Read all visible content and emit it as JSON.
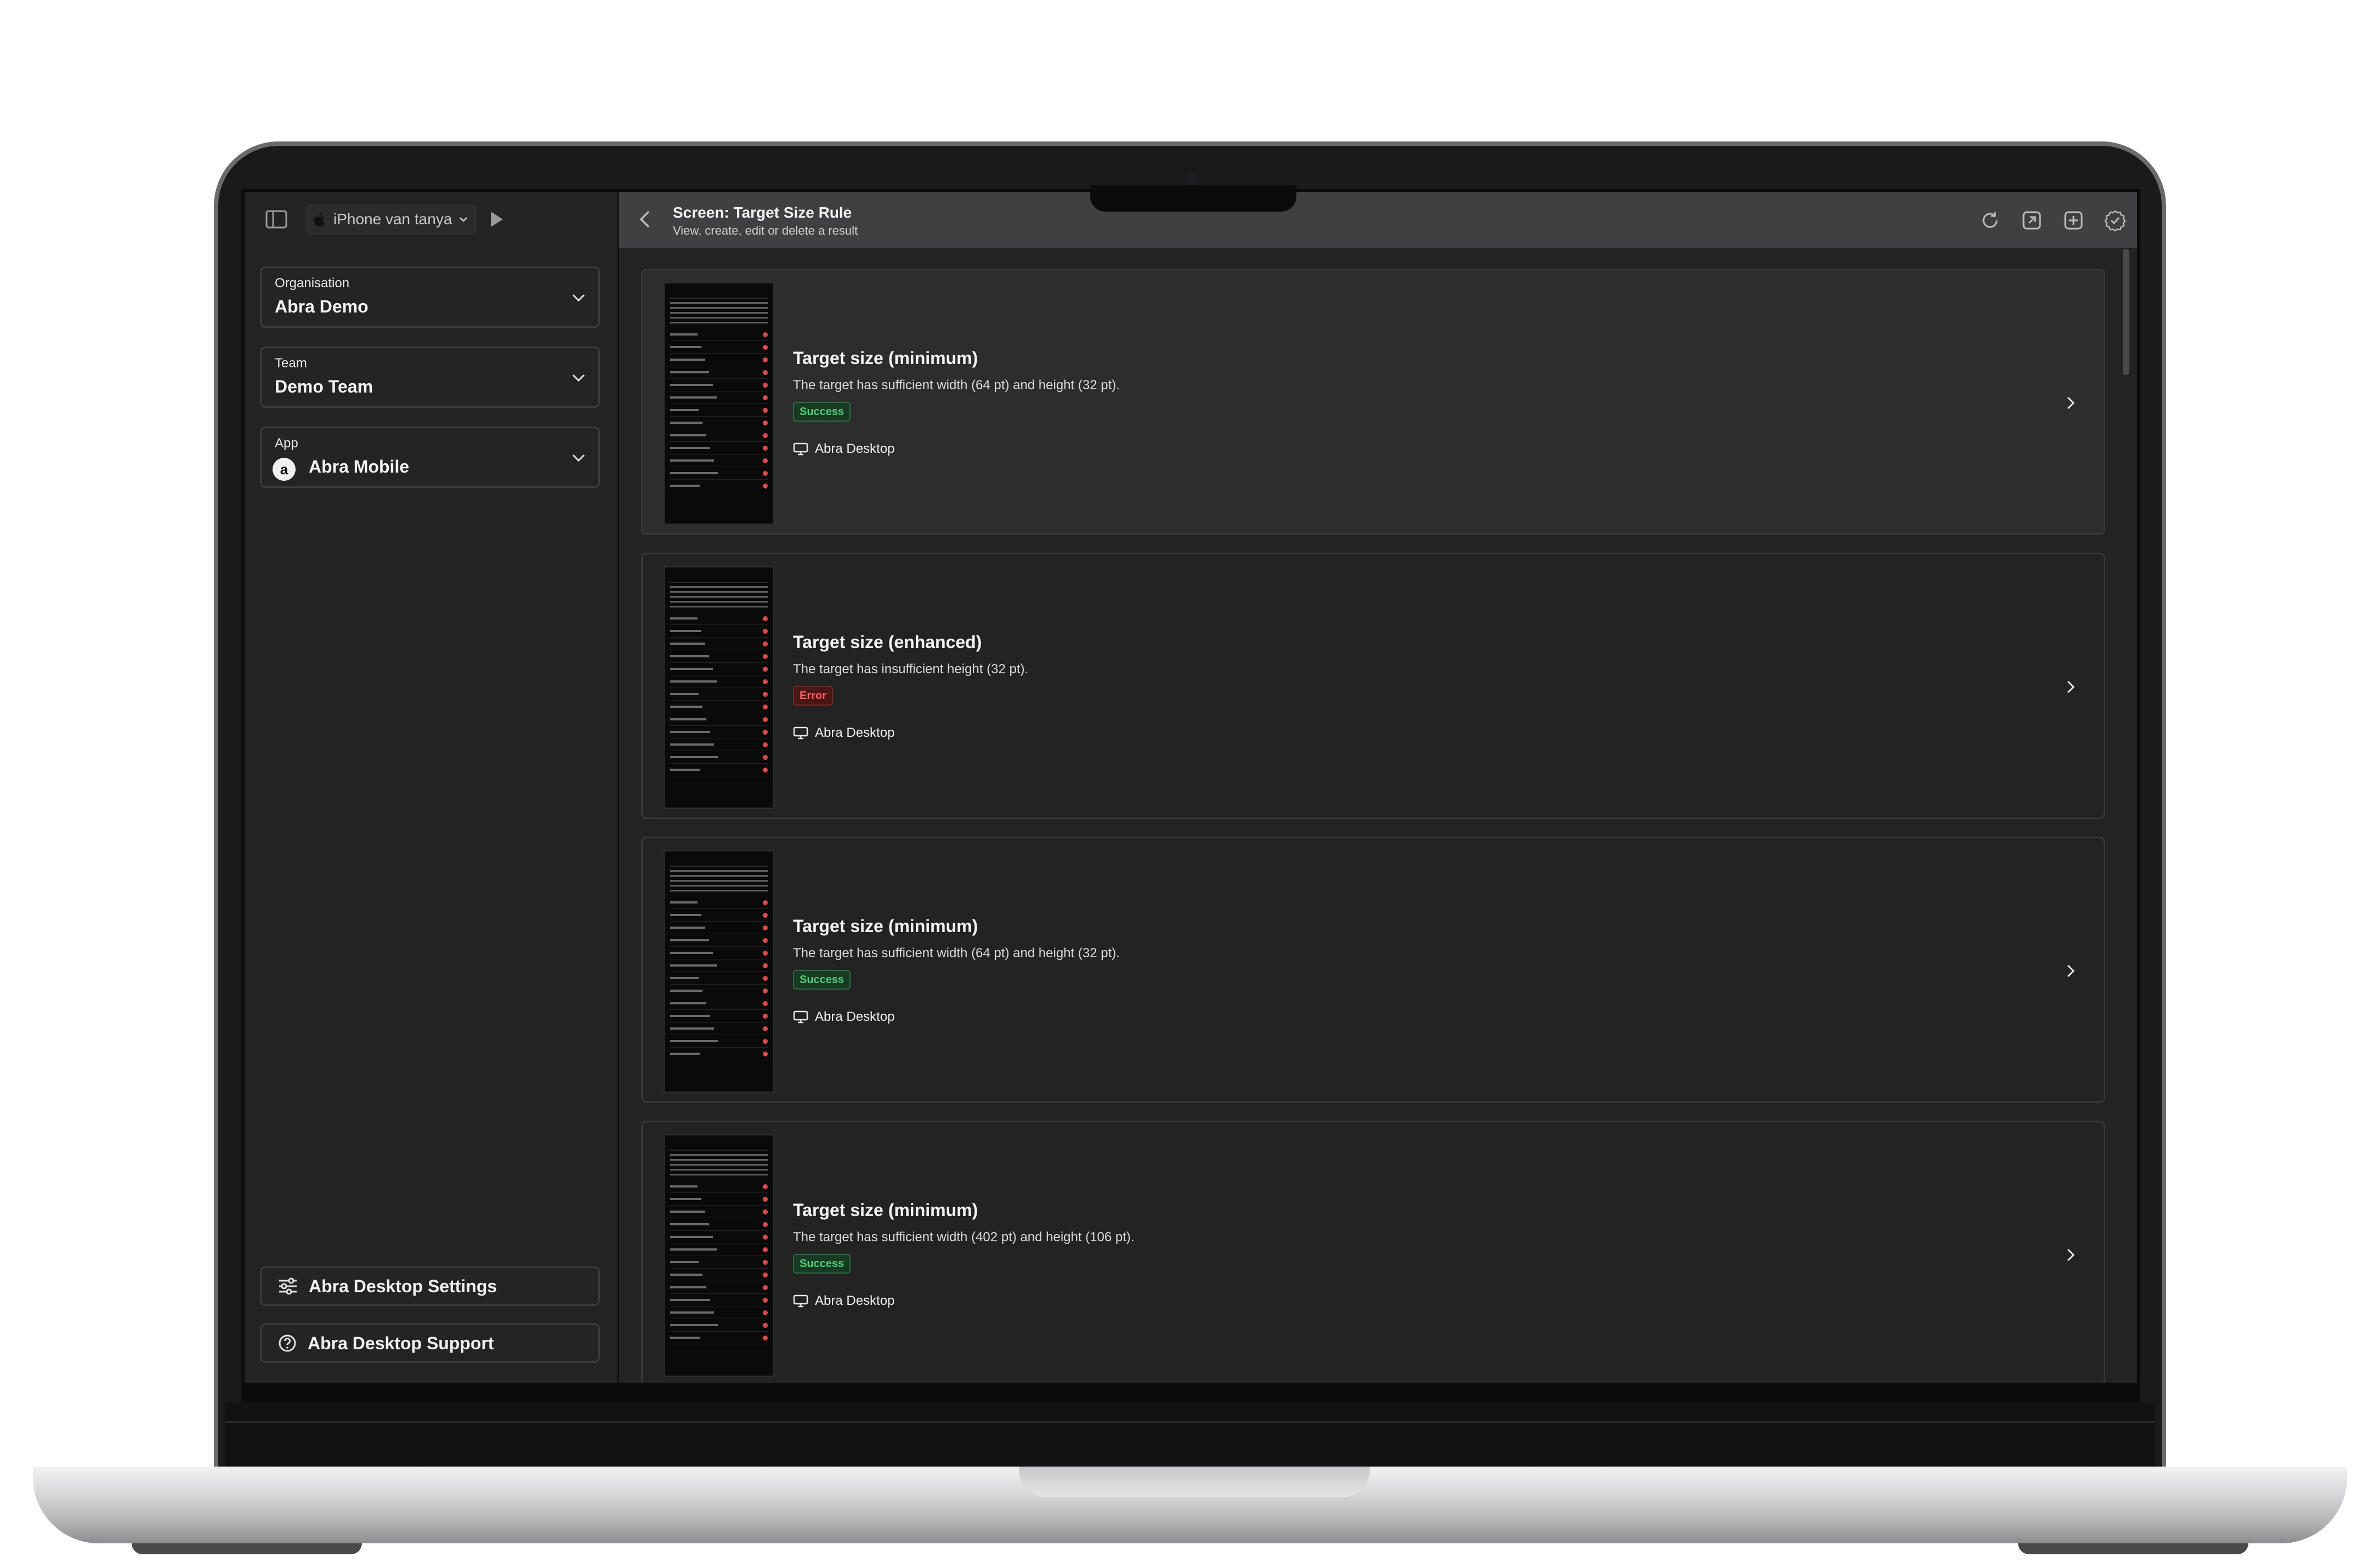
{
  "toolbar": {
    "device_name": "iPhone van tanya",
    "sidebar_toggle_icon": "sidebar-icon",
    "play_icon": "play-icon"
  },
  "sidebar": {
    "organisation": {
      "label": "Organisation",
      "value": "Abra Demo"
    },
    "team": {
      "label": "Team",
      "value": "Demo Team"
    },
    "app": {
      "label": "App",
      "value": "Abra Mobile",
      "avatar": "a"
    },
    "footer": [
      {
        "label": "Abra Desktop Settings",
        "icon": "sliders-icon"
      },
      {
        "label": "Abra Desktop Support",
        "icon": "help-circle-icon"
      }
    ]
  },
  "header": {
    "title": "Screen: Target Size Rule",
    "subtitle": "View, create, edit or delete a result",
    "actions": [
      "refresh-icon",
      "open-external-icon",
      "add-icon",
      "check-badge-icon"
    ]
  },
  "results": [
    {
      "title": "Target size (minimum)",
      "description": "The target has sufficient width (64 pt) and height (32 pt).",
      "status": "Success",
      "source": "Abra Desktop"
    },
    {
      "title": "Target size (enhanced)",
      "description": "The target has insufficient height (32 pt).",
      "status": "Error",
      "source": "Abra Desktop"
    },
    {
      "title": "Target size (minimum)",
      "description": "The target has sufficient width (64 pt) and height (32 pt).",
      "status": "Success",
      "source": "Abra Desktop"
    },
    {
      "title": "Target size (minimum)",
      "description": "The target has sufficient width (402 pt) and height (106 pt).",
      "status": "Success",
      "source": "Abra Desktop"
    }
  ],
  "colors": {
    "success": "#4fd07a",
    "error": "#ff5a5a",
    "background": "#232323",
    "header": "#404042"
  }
}
